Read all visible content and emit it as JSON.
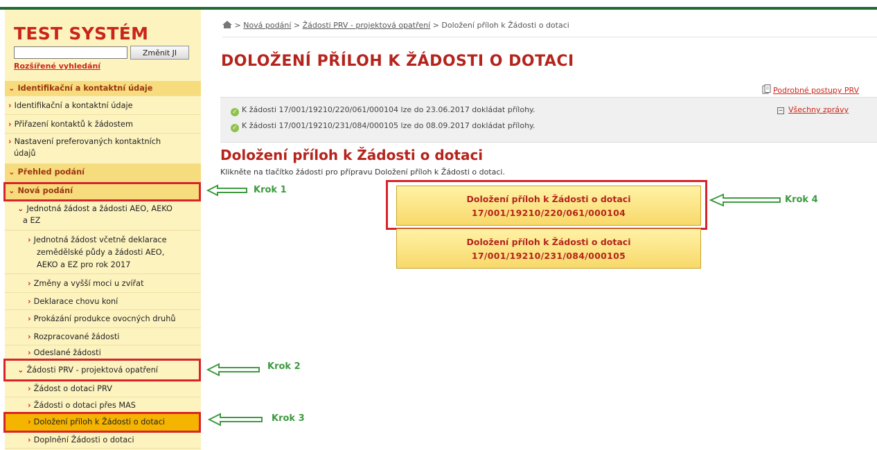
{
  "header": {
    "brand": "TEST SYSTÉM",
    "search_button": "Změnit JI",
    "search_value": "",
    "advanced_search": "Rozšířené vyhledání"
  },
  "sidebar": {
    "items": [
      {
        "label": "Identifikační a kontaktní údaje",
        "type": "section",
        "marker": "⌄"
      },
      {
        "label": "Identifikační a kontaktní údaje",
        "type": "item",
        "marker": "›"
      },
      {
        "label": "Přiřazení kontaktů k žádostem",
        "type": "item",
        "marker": "›"
      },
      {
        "label": "Nastavení preferovaných kontaktních",
        "label2": "údajů",
        "type": "item",
        "marker": "›"
      },
      {
        "label": "Přehled podání",
        "type": "section",
        "marker": "⌄"
      },
      {
        "label": "Nová podání",
        "type": "section",
        "marker": "⌄"
      },
      {
        "label": "Jednotná žádost a žádosti AEO, AEKO",
        "label2": "a EZ",
        "type": "group",
        "marker": "⌄"
      },
      {
        "label": "Jednotná žádost včetně deklarace",
        "label2": "zemědělské půdy a žádosti AEO,",
        "label3": "AEKO a EZ pro rok 2017",
        "type": "subitem",
        "marker": "›"
      },
      {
        "label": "Změny a vyšší moci u zvířat",
        "type": "subitem",
        "marker": "›"
      },
      {
        "label": "Deklarace chovu koní",
        "type": "subitem",
        "marker": "›"
      },
      {
        "label": "Prokázání produkce ovocných druhů",
        "type": "subitem",
        "marker": "›"
      },
      {
        "label": "Rozpracované žádosti",
        "type": "subitem",
        "marker": "›"
      },
      {
        "label": "Odeslané žádosti",
        "type": "subitem",
        "marker": "›"
      },
      {
        "label": "Žádosti PRV - projektová opatření",
        "type": "group",
        "marker": "⌄"
      },
      {
        "label": "Žádost o dotaci PRV",
        "type": "subitem",
        "marker": "›"
      },
      {
        "label": "Žádosti o dotaci přes MAS",
        "type": "subitem",
        "marker": "›"
      },
      {
        "label": "Doložení příloh k Žádosti o dotaci",
        "type": "subitem",
        "marker": "›",
        "active": true
      },
      {
        "label": "Doplnění Žádosti o dotaci",
        "type": "subitem",
        "marker": "›"
      }
    ]
  },
  "annotations": {
    "krok1": "Krok 1",
    "krok2": "Krok 2",
    "krok3": "Krok 3",
    "krok4": "Krok 4",
    "color": "#d7242a",
    "arrow_color": "#3c9a3f"
  },
  "breadcrumb": {
    "home_icon": "home-icon",
    "items": [
      "Nová podání",
      "Žádosti PRV - projektová opatření",
      "Doložení příloh k Žádosti o dotaci"
    ],
    "separator": ">"
  },
  "main": {
    "title": "DOLOŽENÍ PŘÍLOH K ŽÁDOSTI O DOTACI",
    "procedures_link": "Podrobné postupy PRV",
    "messages": [
      "K žádosti 17/001/19210/220/061/000104 lze do 23.06.2017 dokládat přílohy.",
      "K žádosti 17/001/19210/231/084/000105 lze do 08.09.2017 dokládat přílohy."
    ],
    "all_messages": "Všechny zprávy",
    "subtitle": "Doložení příloh k Žádosti o dotaci",
    "instruction": "Klikněte na tlačítko žádosti pro přípravu Doložení příloh k Žádosti o dotaci.",
    "buttons": [
      {
        "line1": "Doložení příloh k Žádosti o dotaci",
        "line2": "17/001/19210/220/061/000104"
      },
      {
        "line1": "Doložení příloh k Žádosti o dotaci",
        "line2": "17/001/19210/231/084/000105"
      }
    ]
  },
  "colors": {
    "accent_red": "#b5241c",
    "sidebar_bg": "#fdf3bf",
    "section_bg": "#f6dc7c",
    "active_bg": "#f5b400",
    "top_bar": "#1f6b33"
  }
}
